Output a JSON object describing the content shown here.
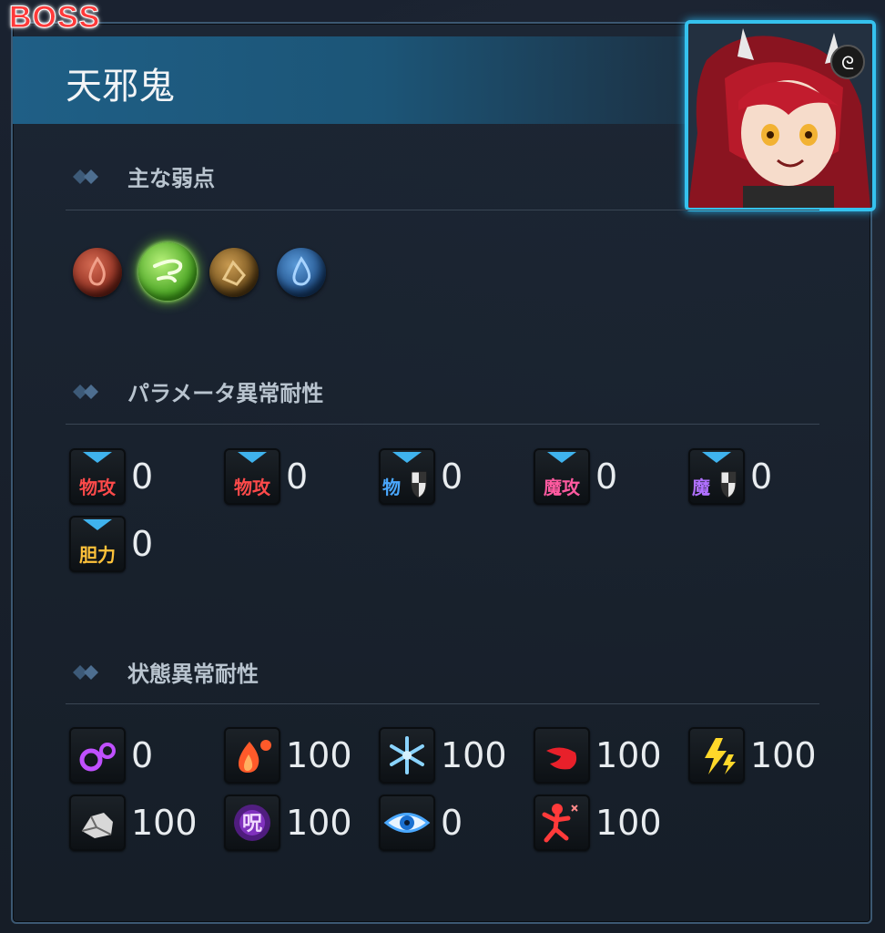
{
  "boss_tag": "BOSS",
  "title": "天邪鬼",
  "sections": {
    "weakness": "主な弱点",
    "param_resist": "パラメータ異常耐性",
    "status_resist": "状態異常耐性"
  },
  "weaknesses": [
    {
      "element": "fire",
      "icon": "fire-element-icon",
      "active": false
    },
    {
      "element": "wind",
      "icon": "wind-element-icon",
      "active": true
    },
    {
      "element": "earth",
      "icon": "earth-element-icon",
      "active": false
    },
    {
      "element": "water",
      "icon": "water-element-icon",
      "active": false
    }
  ],
  "param_resist": [
    {
      "label": "物攻",
      "value": "0",
      "color": "#ff4a4a"
    },
    {
      "label": "物攻",
      "value": "0",
      "color": "#ff4a4a"
    },
    {
      "label": "物",
      "value": "0",
      "color": "#4aa8ff",
      "shield": true
    },
    {
      "label": "魔攻",
      "value": "0",
      "color": "#ff5aa0"
    },
    {
      "label": "魔",
      "value": "0",
      "color": "#b070ff",
      "shield": true
    },
    {
      "label": "胆力",
      "value": "0",
      "color": "#ffc23a"
    }
  ],
  "status_resist": [
    {
      "icon": "rings-icon",
      "value": "0"
    },
    {
      "icon": "burn-icon",
      "value": "100"
    },
    {
      "icon": "freeze-icon",
      "value": "100"
    },
    {
      "icon": "bleed-icon",
      "value": "100"
    },
    {
      "icon": "shock-icon",
      "value": "100"
    },
    {
      "icon": "petrify-icon",
      "value": "100"
    },
    {
      "icon": "curse-icon",
      "value": "100"
    },
    {
      "icon": "eye-icon",
      "value": "0"
    },
    {
      "icon": "panic-icon",
      "value": "100"
    }
  ],
  "curse_glyph": "呪",
  "colors": {
    "accent": "#35c2ee",
    "boss_red": "#ff3a3a",
    "title_bar": "#1f5f86"
  }
}
